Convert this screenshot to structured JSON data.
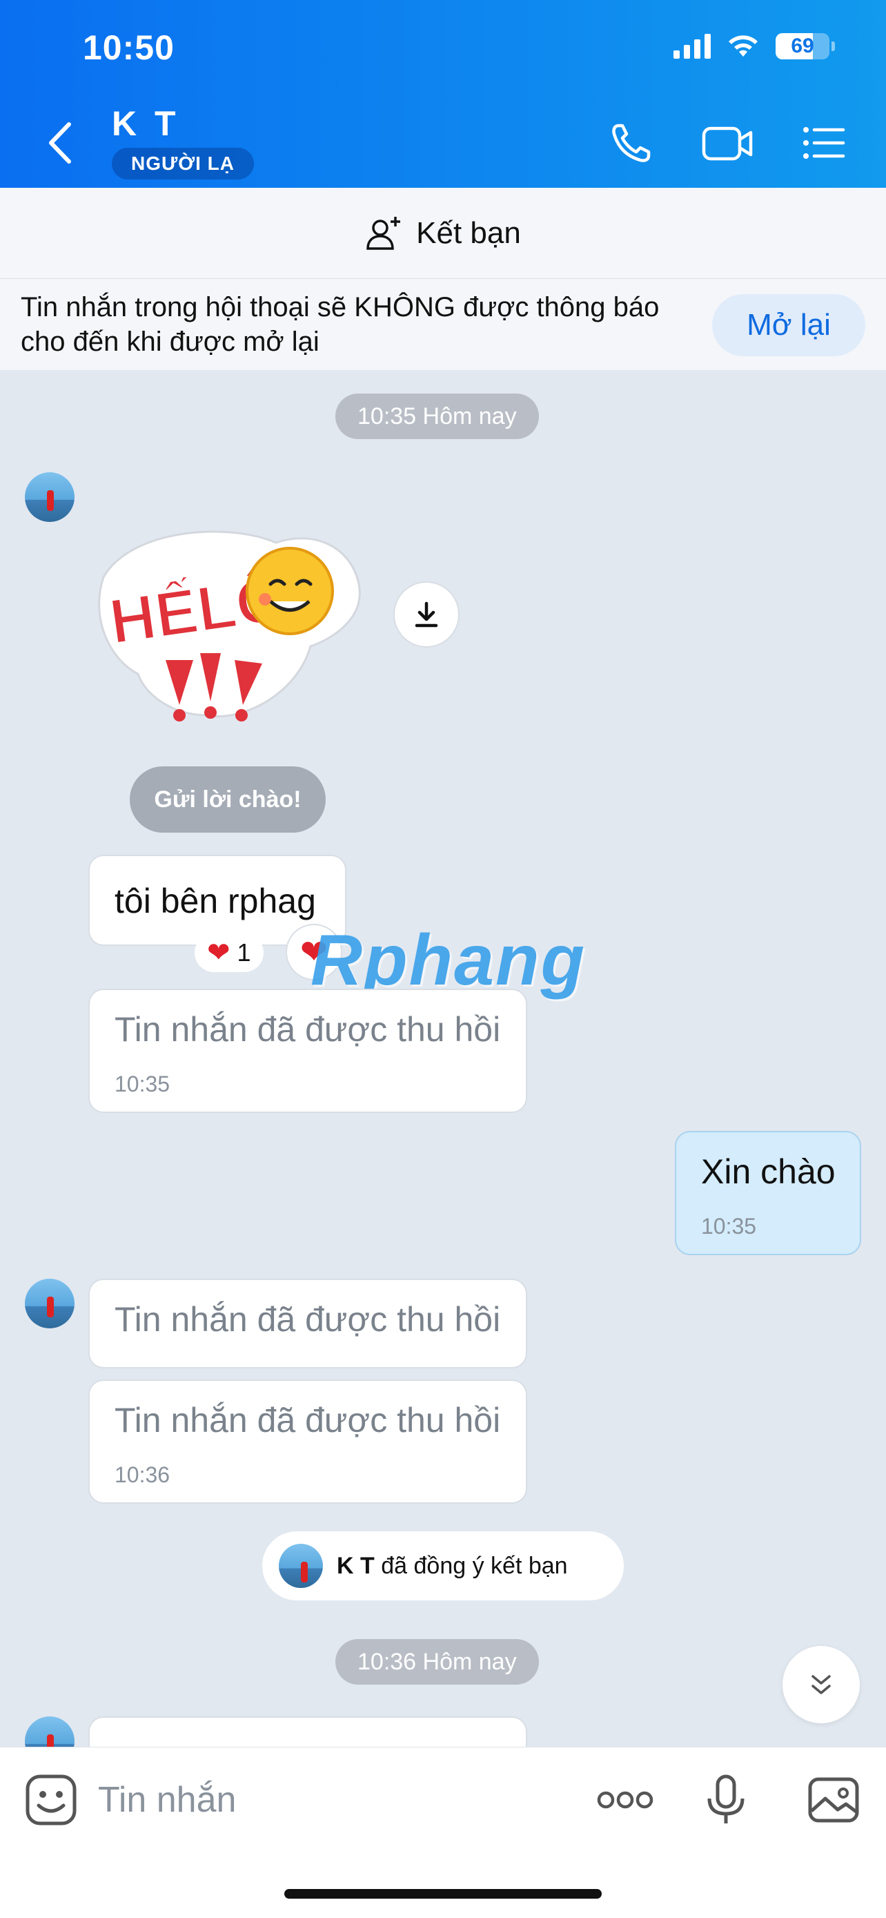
{
  "status_bar": {
    "time": "10:50",
    "battery": "69"
  },
  "header": {
    "title": "K T",
    "badge": "NGƯỜI LẠ"
  },
  "add_friend": {
    "label": "Kết bạn"
  },
  "notice": {
    "text": "Tin nhắn trong hội thoại sẽ KHÔNG được thông báo cho đến khi được mở lại",
    "action": "Mở lại"
  },
  "chat": {
    "time_divider_1": "10:35 Hôm nay",
    "sticker_text": "HẾLÔ",
    "greet_button": "Gửi lời chào!",
    "msg_1": "tôi bên rphag",
    "reaction_count": "1",
    "watermark": "Rphang",
    "recalled_1": {
      "text": "Tin nhắn đã được thu hồi",
      "time": "10:35"
    },
    "mine_1": {
      "text": "Xin chào",
      "time": "10:35"
    },
    "recalled_2": {
      "text": "Tin nhắn đã được thu hồi"
    },
    "recalled_3": {
      "text": "Tin nhắn đã được thu hồi",
      "time": "10:36"
    },
    "accept_name": "K T",
    "accept_text": "đã đồng ý kết bạn",
    "time_divider_2": "10:36 Hôm nay"
  },
  "composer": {
    "placeholder": "Tin nhắn"
  },
  "colors": {
    "header_start": "#0a6ff0",
    "header_end": "#119aee",
    "chat_bg": "#e2e8f0",
    "accent": "#0e6be0",
    "my_bubble": "#d4ecfb"
  }
}
